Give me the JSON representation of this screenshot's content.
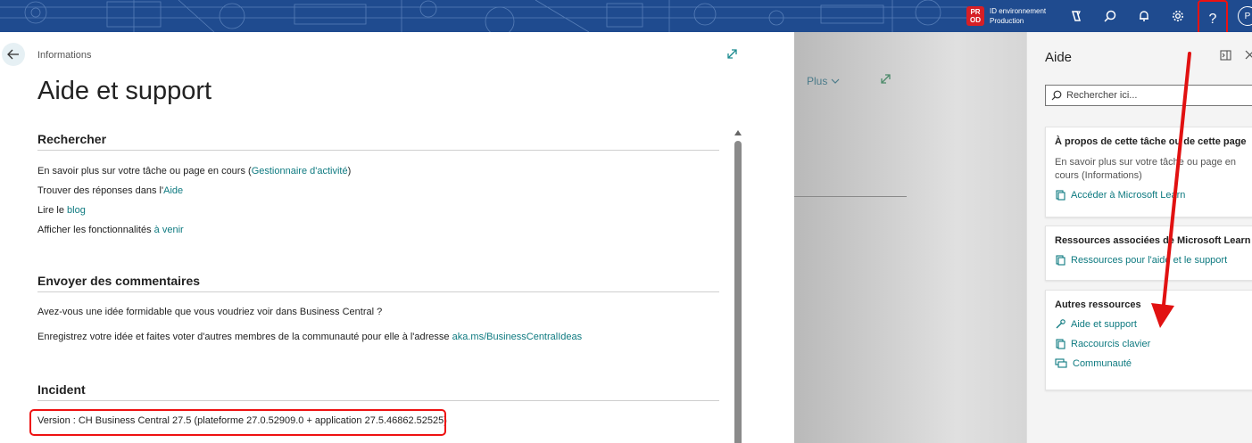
{
  "topbar": {
    "env_badge": "PR OD",
    "env_label": "ID environnement",
    "env_name": "Production",
    "avatar_initial": "P",
    "help_glyph": "?",
    "icons": [
      "copilot-icon",
      "search-icon",
      "bell-icon",
      "gear-icon",
      "help-icon"
    ]
  },
  "info": {
    "breadcrumb": "Informations",
    "title": "Aide et support",
    "sections": {
      "search": {
        "heading": "Rechercher",
        "line1_text": "En savoir plus sur votre tâche ou page en cours (",
        "line1_link": "Gestionnaire d'activité",
        "line1_end": ")",
        "line2_text": "Trouver des réponses dans l'",
        "line2_link": "Aide",
        "line3_text": "Lire le ",
        "line3_link": "blog",
        "line4_text": "Afficher les fonctionnalités ",
        "line4_link": "à venir"
      },
      "feedback": {
        "heading": "Envoyer des commentaires",
        "line1": "Avez-vous une idée formidable que vous voudriez voir dans Business Central ?",
        "line2_text": "Enregistrez votre idée et faites voter d'autres membres de la communauté pour elle à l'adresse ",
        "line2_link": "aka.ms/BusinessCentralIdeas"
      },
      "incident": {
        "heading": "Incident",
        "version": "Version : CH Business Central 27.5 (plateforme 27.0.52909.0 + application 27.5.46862.52525)"
      }
    }
  },
  "middle": {
    "more_label": "Plus"
  },
  "help": {
    "title": "Aide",
    "search_placeholder": "Rechercher ici...",
    "cards": [
      {
        "title": "À propos de cette tâche ou de cette page",
        "desc": "En savoir plus sur votre tâche ou page en cours (Informations)",
        "links": [
          "Accéder à Microsoft Learn"
        ]
      },
      {
        "title": "Ressources associées de Microsoft Learn",
        "links": [
          "Ressources pour l'aide et le support"
        ]
      },
      {
        "title": "Autres ressources",
        "links": [
          "Aide et support",
          "Raccourcis clavier",
          "Communauté"
        ]
      }
    ]
  },
  "colors": {
    "accent": "#0e7a80",
    "topbar": "#1f4b8f",
    "annotation_red": "#e11111"
  }
}
